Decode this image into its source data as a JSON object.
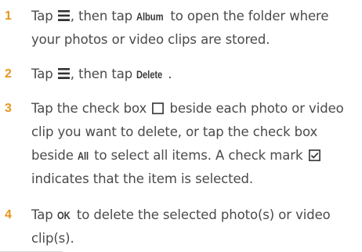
{
  "steps": [
    {
      "number": "1",
      "parts": {
        "a": "Tap ",
        "b": ", then tap ",
        "kw": "Album",
        "c": " to open the folder where",
        "line2": "your photos or video clips are stored."
      }
    },
    {
      "number": "2",
      "parts": {
        "a": "Tap ",
        "b": ", then tap ",
        "kw": "Delete",
        "c": "."
      }
    },
    {
      "number": "3",
      "parts": {
        "a": "Tap the check box ",
        "b": " beside each photo or video",
        "line2": "clip you want to delete, or tap the check box",
        "line3a": "beside ",
        "kw": "All",
        "line3b": " to select all items. A check mark ",
        "line4": "indicates that the item is selected."
      }
    },
    {
      "number": "4",
      "parts": {
        "a": "Tap ",
        "kw": "OK",
        "b": " to delete the selected photo(s) or video",
        "line2": "clip(s)."
      }
    }
  ],
  "icons": {
    "menu": "menu-icon",
    "checkbox_empty": "checkbox-empty-icon",
    "checkbox_checked": "checkbox-checked-icon"
  },
  "colors": {
    "step_number": "#e8961e",
    "body_text": "#4a4a4a",
    "corner_tab": "#d9d9d9"
  }
}
